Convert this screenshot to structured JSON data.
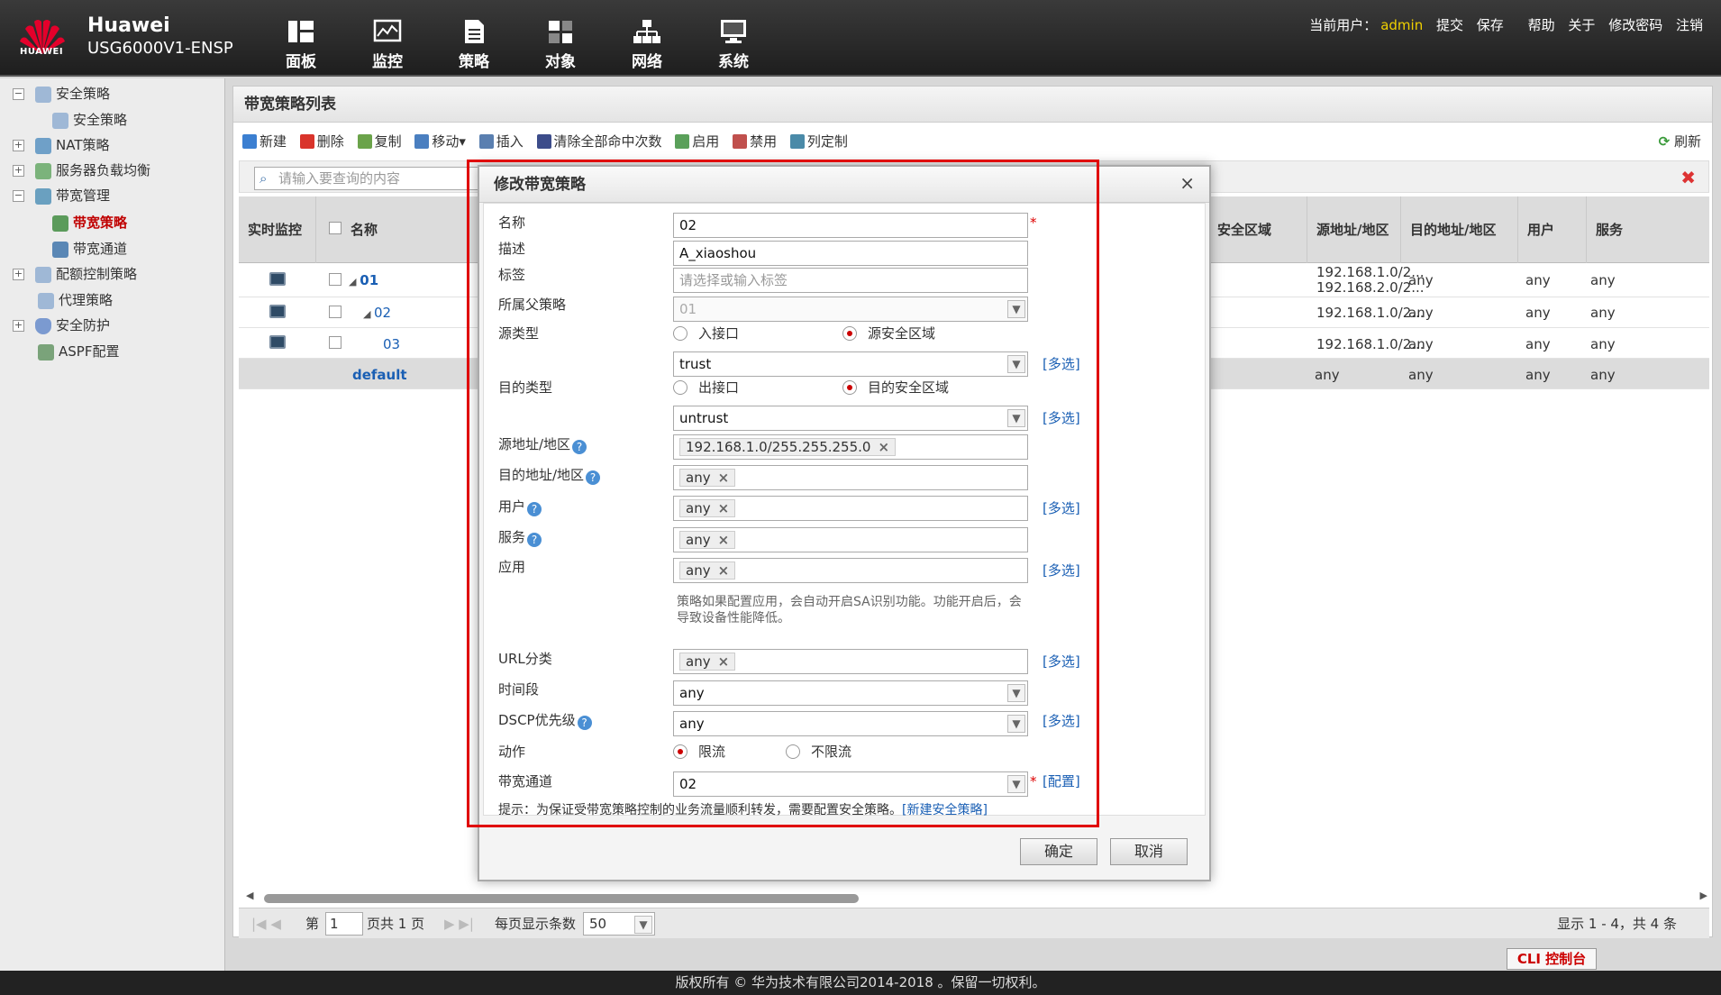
{
  "header": {
    "brand": "Huawei",
    "logo_text": "HUAWEI",
    "model": "USG6000V1-ENSP",
    "nav": [
      {
        "label": "面板",
        "icon": "dashboard-icon"
      },
      {
        "label": "监控",
        "icon": "monitor-icon"
      },
      {
        "label": "策略",
        "icon": "policy-icon"
      },
      {
        "label": "对象",
        "icon": "object-icon"
      },
      {
        "label": "网络",
        "icon": "network-icon"
      },
      {
        "label": "系统",
        "icon": "system-icon"
      }
    ],
    "user_label": "当前用户：",
    "user": "admin",
    "links": [
      "提交",
      "保存",
      "帮助",
      "关于",
      "修改密码",
      "注销"
    ]
  },
  "sidebar": {
    "items": [
      {
        "label": "安全策略",
        "expander": "−"
      },
      {
        "label": "安全策略"
      },
      {
        "label": "NAT策略",
        "expander": "+"
      },
      {
        "label": "服务器负载均衡",
        "expander": "+"
      },
      {
        "label": "带宽管理",
        "expander": "−"
      },
      {
        "label": "带宽策略"
      },
      {
        "label": "带宽通道"
      },
      {
        "label": "配额控制策略",
        "expander": "+"
      },
      {
        "label": "代理策略"
      },
      {
        "label": "安全防护",
        "expander": "+"
      },
      {
        "label": "ASPF配置"
      }
    ]
  },
  "main": {
    "title": "带宽策略列表",
    "toolbar": [
      "新建",
      "删除",
      "复制",
      "移动▾",
      "插入",
      "清除全部命中次数",
      "启用",
      "禁用",
      "列定制"
    ],
    "refresh": "刷新",
    "search_placeholder": "请输入要查询的内容",
    "columns": {
      "monitor": "实时监控",
      "name": "名称",
      "src_zone": "安全区域",
      "src_addr": "源地址/地区",
      "dst_addr": "目的地址/地区",
      "user": "用户",
      "service": "服务"
    },
    "rows": [
      {
        "name": "01",
        "src_addr": "192.168.1.0/2...",
        "src_addr2": "192.168.2.0/2...",
        "dst_addr": "any",
        "user": "any",
        "service": "any"
      },
      {
        "name": "02",
        "src_addr": "192.168.1.0/2...",
        "dst_addr": "any",
        "user": "any",
        "service": "any"
      },
      {
        "name": "03",
        "src_addr": "192.168.1.0/2...",
        "dst_addr": "any",
        "user": "any",
        "service": "any"
      },
      {
        "name": "default",
        "src_addr": "any",
        "dst_addr": "any",
        "user": "any",
        "service": "any"
      }
    ],
    "pager": {
      "page_label": "第",
      "page": "1",
      "of_label": "页共 1 页",
      "per_page_label": "每页显示条数",
      "per_page": "50",
      "summary": "显示 1 - 4，共 4 条"
    }
  },
  "dialog": {
    "title": "修改带宽策略",
    "labels": {
      "name": "名称",
      "desc": "描述",
      "tag": "标签",
      "parent": "所属父策略",
      "src_type": "源类型",
      "dst_type": "目的类型",
      "src_addr": "源地址/地区",
      "dst_addr": "目的地址/地区",
      "user": "用户",
      "service": "服务",
      "app": "应用",
      "url": "URL分类",
      "time": "时间段",
      "dscp": "DSCP优先级",
      "action": "动作",
      "channel": "带宽通道"
    },
    "values": {
      "name": "02",
      "desc": "A_xiaoshou",
      "tag_placeholder": "请选择或输入标签",
      "parent": "01",
      "src_zone": "trust",
      "dst_zone": "untrust",
      "src_addr": "192.168.1.0/255.255.255.0",
      "dst_addr": "any",
      "user": "any",
      "service": "any",
      "app": "any",
      "url": "any",
      "time": "any",
      "dscp": "any",
      "channel": "02"
    },
    "radios": {
      "src_if": "入接口",
      "src_zone": "源安全区域",
      "dst_if": "出接口",
      "dst_zone": "目的安全区域",
      "limit": "限流",
      "nolimit": "不限流"
    },
    "multi": "[多选]",
    "config": "[配置]",
    "star": "*",
    "help_glyph": "?",
    "app_note": "策略如果配置应用，会自动开启SA识别功能。功能开启后，会导致设备性能降低。",
    "tip": "提示：为保证受带宽策略控制的业务流量顺利转发，需要配置安全策略。",
    "tip_link": "[新建安全策略]",
    "ok": "确定",
    "cancel": "取消"
  },
  "footer": "版权所有 © 华为技术有限公司2014-2018 。保留一切权利。",
  "cli": "CLI 控制台"
}
